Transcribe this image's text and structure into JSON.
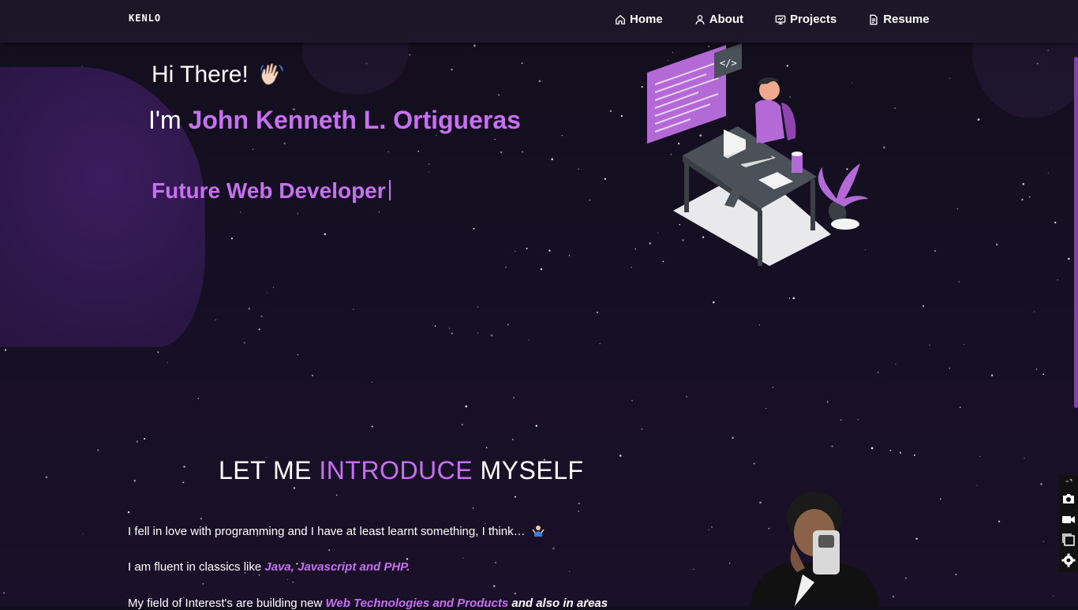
{
  "nav": {
    "brand": "KENLO",
    "items": [
      {
        "label": "Home",
        "icon": "home-icon"
      },
      {
        "label": "About",
        "icon": "user-icon"
      },
      {
        "label": "Projects",
        "icon": "projects-icon"
      },
      {
        "label": "Resume",
        "icon": "document-icon"
      }
    ]
  },
  "hero": {
    "greeting": "Hi There!",
    "greeting_icon": "waving-hand-icon",
    "name_prefix": "I'm",
    "name": "John Kenneth L. Ortigueras",
    "role": "Future Web Developer"
  },
  "intro": {
    "title_a": "LET ME",
    "title_hl": "INTRODUCE",
    "title_b": "MYSELF",
    "p1_text": "I fell in love with programming and I have at least learnt something, I think…",
    "p1_icon": "shrug-icon",
    "p2_text": "I am fluent in classics like",
    "p2_em": "Java, Javascript and PHP.",
    "p3_text": "My field of Interest's are building new",
    "p3_em": "Web Technologies and Products",
    "p3_tail": "and also in areas"
  },
  "side_tools": [
    "link-icon",
    "camera-icon",
    "video-icon",
    "window-icon",
    "settings-icon"
  ],
  "colors": {
    "accent": "#c770f0",
    "nav_bg": "#1b1729",
    "bg": "#160f24"
  }
}
